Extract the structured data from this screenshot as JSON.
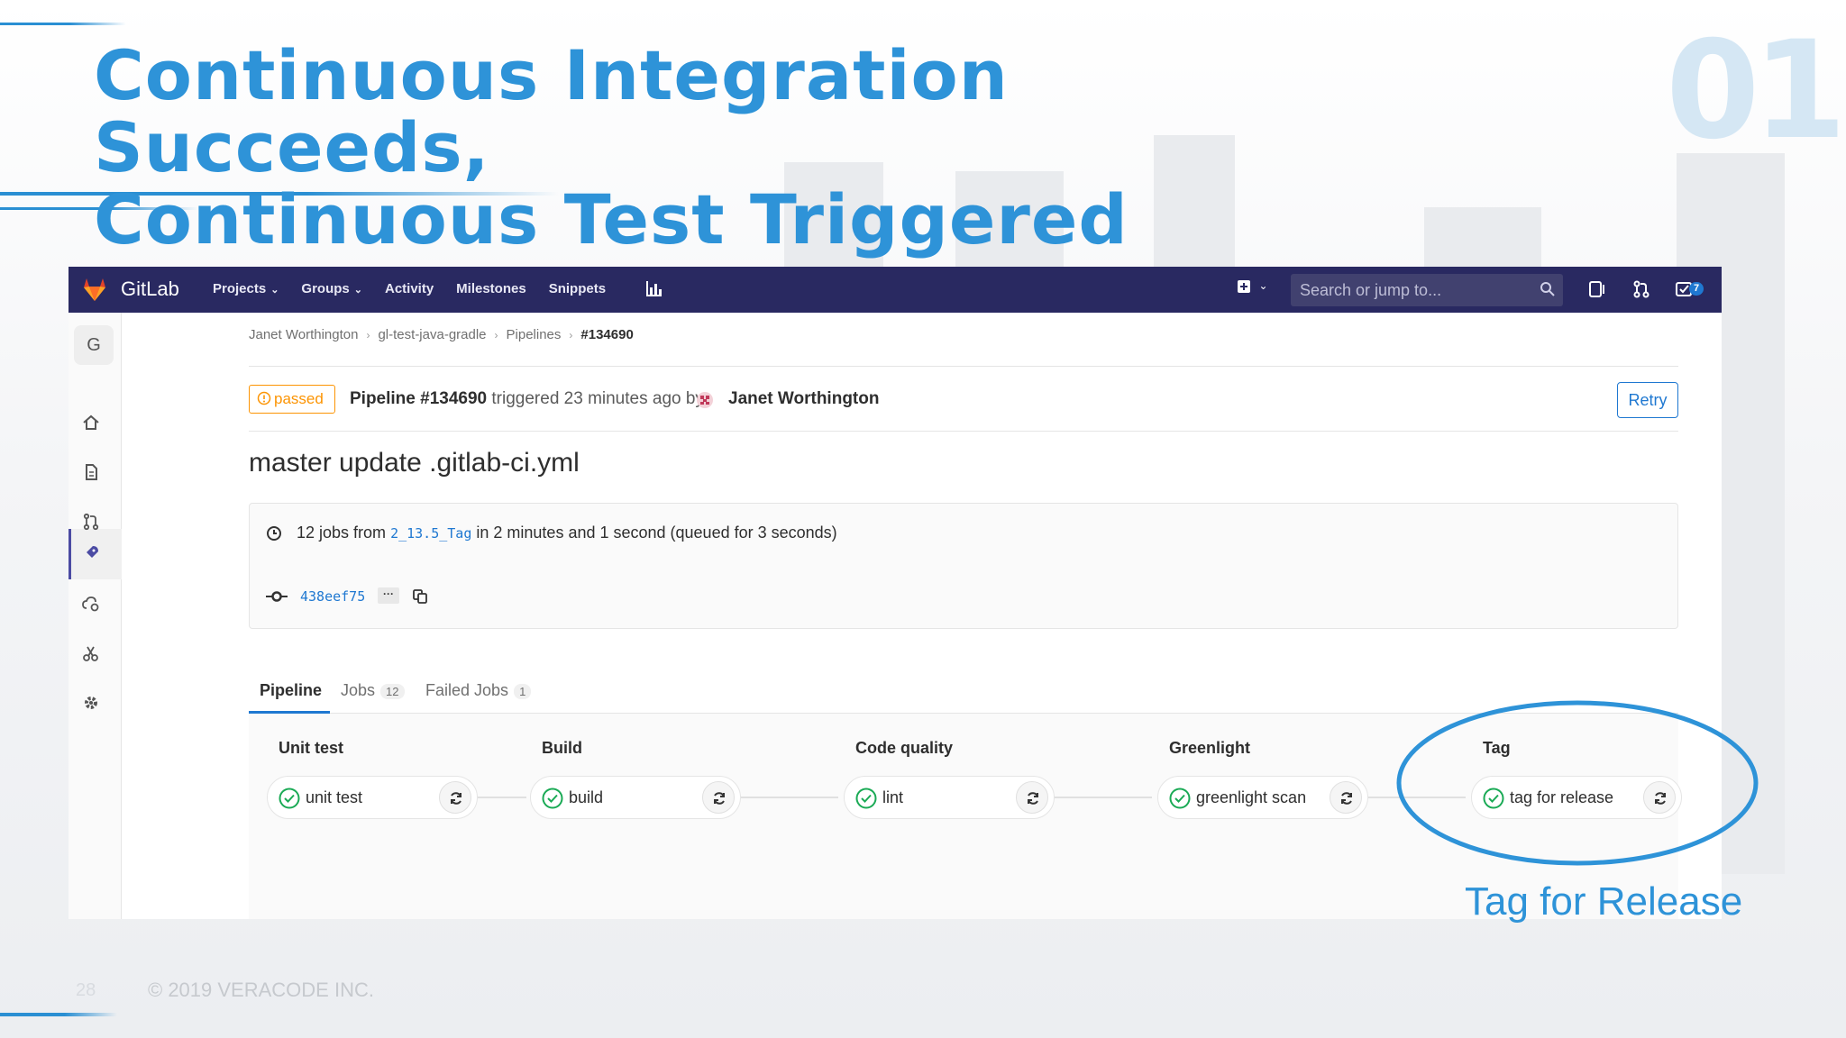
{
  "slide": {
    "title_line1": "Continuous Integration Succeeds,",
    "title_line2": "Continuous Test Triggered",
    "number": "01",
    "page_number": "28",
    "copyright": "© 2019 VERACODE INC."
  },
  "navbar": {
    "brand": "GitLab",
    "items": [
      "Projects",
      "Groups",
      "Activity",
      "Milestones",
      "Snippets"
    ],
    "search_placeholder": "Search or jump to...",
    "todo_count": "7"
  },
  "sidebar": {
    "group_initial": "G",
    "icons": [
      "home-icon",
      "file-icon",
      "merge-request-icon",
      "rocket-icon",
      "cloud-gear-icon",
      "scissors-icon",
      "settings-icon"
    ]
  },
  "breadcrumb": [
    "Janet Worthington",
    "gl-test-java-gradle",
    "Pipelines",
    "#134690"
  ],
  "pipeline": {
    "status": "passed",
    "title": "Pipeline #134690",
    "triggered": "triggered 23 minutes ago by",
    "user": "Janet Worthington",
    "retry_label": "Retry",
    "commit_message": "master update .gitlab-ci.yml",
    "jobs_prefix": "12 jobs from",
    "ref": "2_13.5_Tag",
    "jobs_suffix": "in 2 minutes and 1 second (queued for 3 seconds)",
    "sha": "438eef75",
    "ellipsis": "···"
  },
  "tabs": [
    {
      "label": "Pipeline",
      "count": ""
    },
    {
      "label": "Jobs",
      "count": "12"
    },
    {
      "label": "Failed Jobs",
      "count": "1"
    }
  ],
  "stages": [
    {
      "name": "Unit test",
      "job": "unit test"
    },
    {
      "name": "Build",
      "job": "build"
    },
    {
      "name": "Code quality",
      "job": "lint"
    },
    {
      "name": "Greenlight",
      "job": "greenlight scan"
    },
    {
      "name": "Tag",
      "job": "tag for release"
    }
  ],
  "annotation": {
    "label": "Tag for Release",
    "color": "#2e93d8"
  },
  "colors": {
    "navbar": "#292961",
    "accent": "#1f78d1",
    "success": "#1aaa55",
    "warning": "#fc9403",
    "slide_title": "#2e93d8"
  }
}
